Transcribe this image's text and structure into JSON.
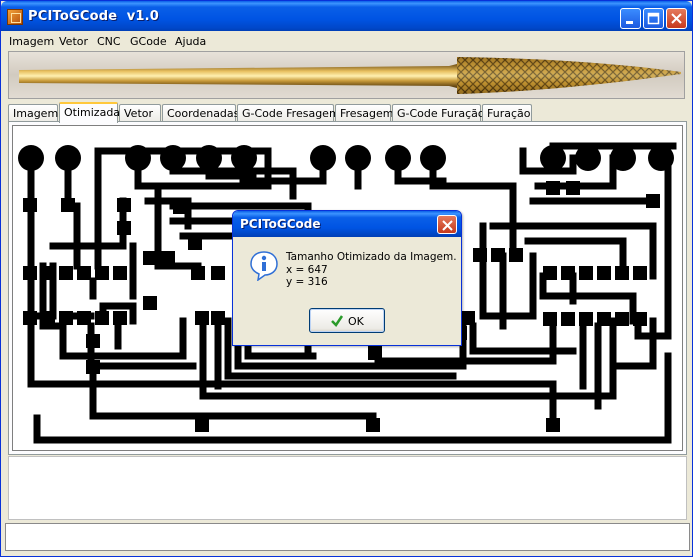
{
  "window": {
    "title": "PCIToGCode  v1.0"
  },
  "menu": {
    "items": [
      "Imagem",
      "Vetor",
      "CNC",
      "GCode",
      "Ajuda"
    ]
  },
  "tabs": {
    "items": [
      "Imagem",
      "Otimizada",
      "Vetor",
      "Coordenadas",
      "G-Code Fresagem",
      "Fresagem",
      "G-Code Furação",
      "Furação"
    ],
    "active": "Otimizada"
  },
  "dialog": {
    "title": "PCIToGCode",
    "message_line1": "Tamanho Otimizado da Imagem.",
    "message_line2": "x = 647",
    "message_line3": "y = 316",
    "ok_label": "OK",
    "icon": "info-icon"
  },
  "colors": {
    "titlebar": "#0054e3",
    "window_bg": "#ece9d8",
    "trace": "#000000",
    "tab_highlight": "#ffc83c",
    "close_button": "#c5391d",
    "ok_check": "#2a9a2a",
    "info_icon": "#2f6fd6"
  }
}
